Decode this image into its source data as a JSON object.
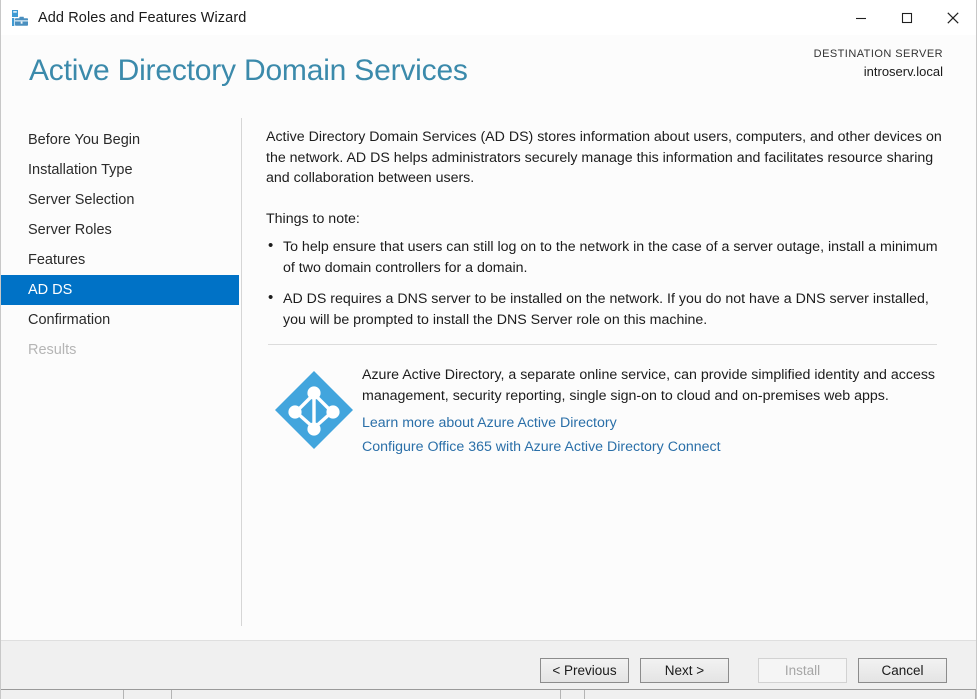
{
  "window": {
    "title": "Add Roles and Features Wizard",
    "app_icon": "server-manager-toolbox-icon",
    "controls": {
      "minimize": "minimize-icon",
      "maximize": "maximize-icon",
      "close": "close-icon"
    }
  },
  "header": {
    "page_title": "Active Directory Domain Services",
    "destination_label": "DESTINATION SERVER",
    "destination_value": "introserv.local"
  },
  "sidebar": {
    "items": [
      {
        "label": "Before You Begin",
        "state": "normal"
      },
      {
        "label": "Installation Type",
        "state": "normal"
      },
      {
        "label": "Server Selection",
        "state": "normal"
      },
      {
        "label": "Server Roles",
        "state": "normal"
      },
      {
        "label": "Features",
        "state": "normal"
      },
      {
        "label": "AD DS",
        "state": "selected"
      },
      {
        "label": "Confirmation",
        "state": "normal"
      },
      {
        "label": "Results",
        "state": "disabled"
      }
    ]
  },
  "content": {
    "intro_paragraph": "Active Directory Domain Services (AD DS) stores information about users, computers, and other devices on the network.  AD DS helps administrators securely manage this information and facilitates resource sharing and collaboration between users.",
    "things_to_note_heading": "Things to note:",
    "notes": [
      "To help ensure that users can still log on to the network in the case of a server outage, install a minimum of two domain controllers for a domain.",
      "AD DS requires a DNS server to be installed on the network.  If you do not have a DNS server installed, you will be prompted to install the DNS Server role on this machine."
    ],
    "azure": {
      "icon": "azure-active-directory-icon",
      "description": "Azure Active Directory, a separate online service, can provide simplified identity and access management, security reporting, single sign-on to cloud and on-premises web apps.",
      "link_learn_more": "Learn more about Azure Active Directory",
      "link_office365": "Configure Office 365 with Azure Active Directory Connect"
    }
  },
  "footer": {
    "previous_label": "< Previous",
    "next_label": "Next >",
    "install_label": "Install",
    "cancel_label": "Cancel",
    "install_enabled": false
  },
  "colors": {
    "accent_blue": "#0072c6",
    "title_teal": "#3b8aab",
    "link_blue": "#2a6fa8",
    "azure_icon_blue": "#42a5dd",
    "page_background": "#fcfcfc",
    "footer_background": "#f0f0f0"
  }
}
